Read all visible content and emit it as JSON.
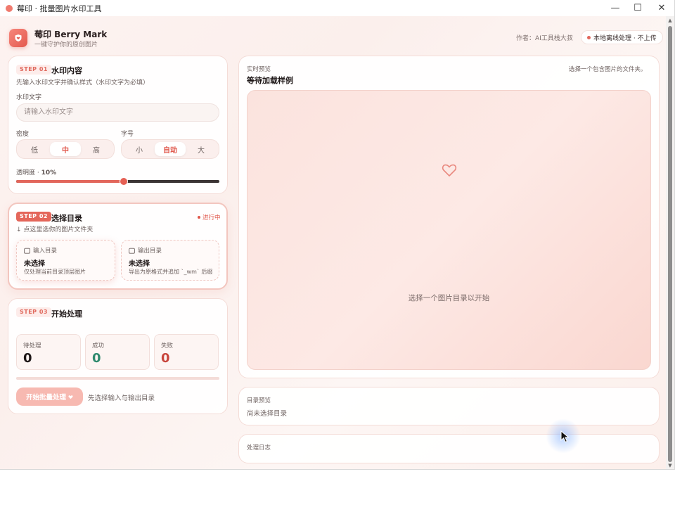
{
  "window": {
    "title": "莓印 · 批量图片水印工具",
    "controls": {
      "minimize": "—",
      "maximize": "☐",
      "close": "✕"
    }
  },
  "header": {
    "brand_name": "莓印 Berry Mark",
    "brand_sub": "一键守护你的原创图片",
    "author": "作者：AI工具栈大叔",
    "local_badge": "本地离线处理 · 不上传"
  },
  "step1": {
    "tag": "STEP 01",
    "title": "水印内容",
    "subtitle": "先输入水印文字并确认样式（水印文字为必填）",
    "text_label": "水印文字",
    "text_placeholder": "请输入水印文字",
    "text_value": "",
    "density_label": "密度",
    "density_options": [
      "低",
      "中",
      "高"
    ],
    "density_selected": "中",
    "fontsize_label": "字号",
    "fontsize_options": [
      "小",
      "自动",
      "大"
    ],
    "fontsize_selected": "自动",
    "opacity_label": "透明度 · ",
    "opacity_value": "10%",
    "opacity_fraction": 0.53
  },
  "step2": {
    "tag": "STEP 02",
    "title": "选择目录",
    "status": "进行中",
    "hint": "↓ 点这里选你的图片文件夹",
    "input_dir": {
      "label": "输入目录",
      "value": "未选择",
      "desc": "仅处理当前目录顶层图片"
    },
    "output_dir": {
      "label": "输出目录",
      "value": "未选择",
      "desc": "导出为原格式并追加 `_wm` 后缀"
    }
  },
  "step3": {
    "tag": "STEP 03",
    "title": "开始处理",
    "stats": [
      {
        "label": "待处理",
        "value": "0",
        "color": "#1f1818"
      },
      {
        "label": "成功",
        "value": "0",
        "color": "#2f8a6e"
      },
      {
        "label": "失败",
        "value": "0",
        "color": "#c8453c"
      }
    ],
    "progress": 0,
    "start_button": "开始批量处理",
    "start_hint": "先选择输入与输出目录"
  },
  "preview": {
    "label": "实时预览",
    "title": "等待加载样例",
    "hint": "选择一个包含图片的文件夹。",
    "empty_message": "选择一个图片目录以开始"
  },
  "directory_preview": {
    "label": "目录预览",
    "value": "尚未选择目录"
  },
  "log": {
    "label": "处理日志"
  },
  "colors": {
    "accent": "#e4665a",
    "success": "#2f8a6e",
    "danger": "#c8453c"
  }
}
